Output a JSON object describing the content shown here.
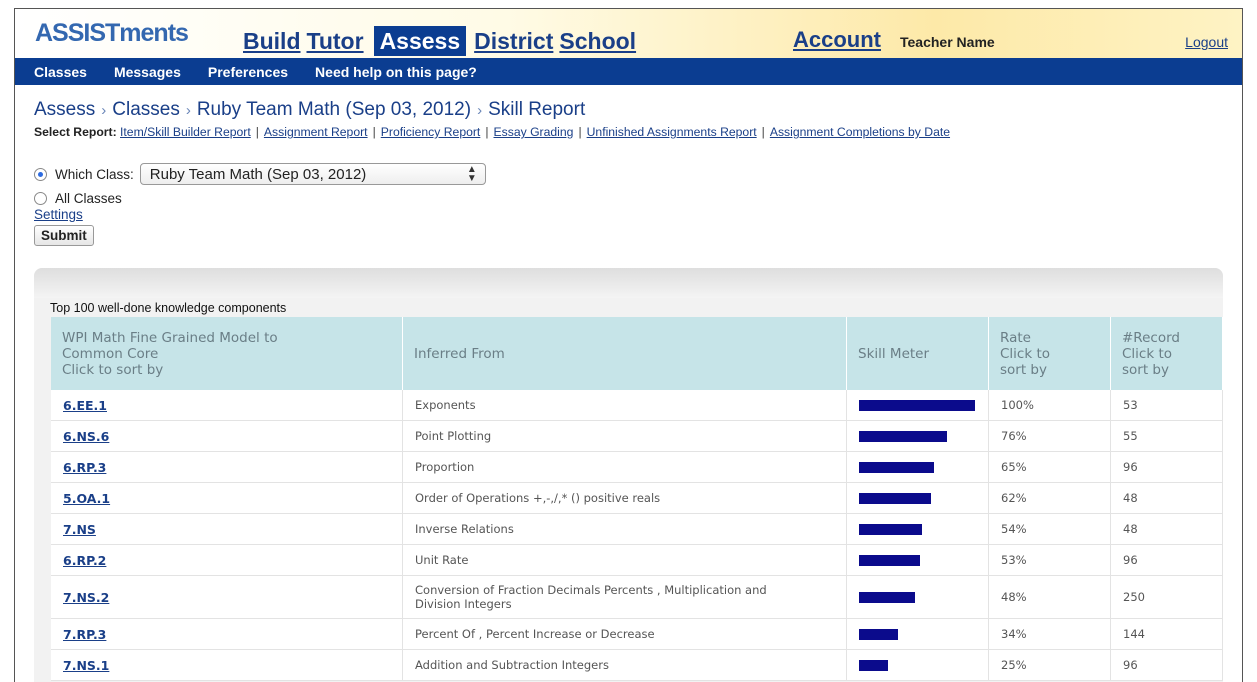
{
  "app": {
    "logo": "ASSISTments"
  },
  "nav": {
    "main": [
      "Build",
      "Tutor",
      "Assess",
      "District",
      "School"
    ],
    "active": "Assess",
    "account": "Account",
    "teacher": "Teacher Name",
    "logout": "Logout"
  },
  "subnav": [
    "Classes",
    "Messages",
    "Preferences",
    "Need help on this page?"
  ],
  "breadcrumb": [
    "Assess",
    "Classes",
    "Ruby Team Math (Sep 03, 2012)",
    "Skill Report"
  ],
  "select_report": {
    "label": "Select Report:",
    "links": [
      "Item/Skill Builder Report",
      "Assignment Report",
      "Proficiency Report",
      "Essay Grading",
      "Unfinished Assignments Report",
      "Assignment Completions by Date"
    ]
  },
  "form": {
    "which_class_label": "Which Class:",
    "which_class_value": "Ruby Team Math (Sep 03, 2012)",
    "all_classes_label": "All Classes",
    "settings": "Settings",
    "submit": "Submit"
  },
  "table": {
    "title": "Top 100 well-done knowledge components",
    "headers": [
      "WPI Math Fine Grained Model to\nCommon Core\nClick to sort by",
      "Inferred From",
      "Skill Meter",
      "Rate\nClick to\nsort by",
      "#Record\nClick to\nsort by"
    ],
    "rows": [
      {
        "code": "6.EE.1",
        "inferred": "Exponents",
        "rate": "100%",
        "records": "53",
        "meter": 1.0
      },
      {
        "code": "6.NS.6",
        "inferred": "Point Plotting",
        "rate": "76%",
        "records": "55",
        "meter": 0.76
      },
      {
        "code": "6.RP.3",
        "inferred": "Proportion",
        "rate": "65%",
        "records": "96",
        "meter": 0.65
      },
      {
        "code": "5.OA.1",
        "inferred": "Order of Operations +,-,/,* () positive reals",
        "rate": "62%",
        "records": "48",
        "meter": 0.62
      },
      {
        "code": "7.NS",
        "inferred": "Inverse Relations",
        "rate": "54%",
        "records": "48",
        "meter": 0.54
      },
      {
        "code": "6.RP.2",
        "inferred": "Unit Rate",
        "rate": "53%",
        "records": "96",
        "meter": 0.53
      },
      {
        "code": "7.NS.2",
        "inferred": "Conversion of Fraction Decimals Percents , Multiplication and Division Integers",
        "rate": "48%",
        "records": "250",
        "meter": 0.48
      },
      {
        "code": "7.RP.3",
        "inferred": "Percent Of , Percent Increase or Decrease",
        "rate": "34%",
        "records": "144",
        "meter": 0.34
      },
      {
        "code": "7.NS.1",
        "inferred": "Addition and Subtraction Integers",
        "rate": "25%",
        "records": "96",
        "meter": 0.25
      }
    ]
  }
}
